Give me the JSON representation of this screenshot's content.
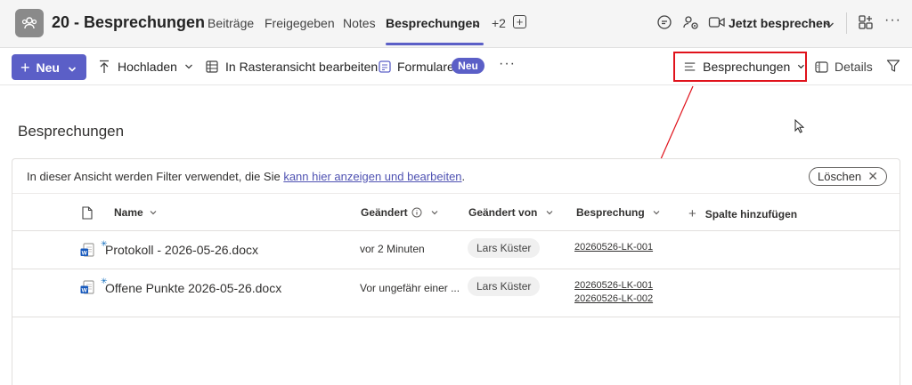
{
  "header": {
    "channel_title": "20 - Besprechungen",
    "tabs": [
      {
        "label": "Beiträge"
      },
      {
        "label": "Freigegeben"
      },
      {
        "label": "Notes"
      },
      {
        "label": "Besprechungen",
        "active": true
      }
    ],
    "more_tabs": "+2",
    "meet_now": "Jetzt besprechen",
    "icons": [
      "team-icon",
      "chat-icon",
      "people-settings-icon",
      "video-icon",
      "apps-icon",
      "more-icon"
    ]
  },
  "commandbar": {
    "new_label": "Neu",
    "upload": "Hochladen",
    "grid_edit": "In Rasteransicht bearbeiten",
    "forms": "Formulare",
    "forms_badge": "Neu",
    "more": "···",
    "view_selector": "Besprechungen",
    "details": "Details"
  },
  "main": {
    "title": "Besprechungen",
    "filter_info": {
      "prefix": "In dieser Ansicht werden Filter verwendet, die Sie ",
      "link": "kann hier anzeigen und bearbeiten",
      "suffix": "."
    },
    "clear_button": "Löschen",
    "columns": {
      "name": "Name",
      "modified": "Geändert",
      "modified_by": "Geändert von",
      "meeting": "Besprechung",
      "add_column": "Spalte hinzufügen"
    },
    "rows": [
      {
        "name": "Protokoll - 2026-05-26.docx",
        "modified": "vor 2 Minuten",
        "modified_by": "Lars Küster",
        "meetings": [
          "20260526-LK-001"
        ]
      },
      {
        "name": "Offene Punkte 2026-05-26.docx",
        "modified": "Vor ungefähr einer ...",
        "modified_by": "Lars Küster",
        "meetings": [
          "20260526-LK-001",
          "20260526-LK-002"
        ]
      }
    ]
  },
  "colors": {
    "accent": "#5b5fc7",
    "annotation": "#e0121b",
    "link": "#4f52b2"
  }
}
